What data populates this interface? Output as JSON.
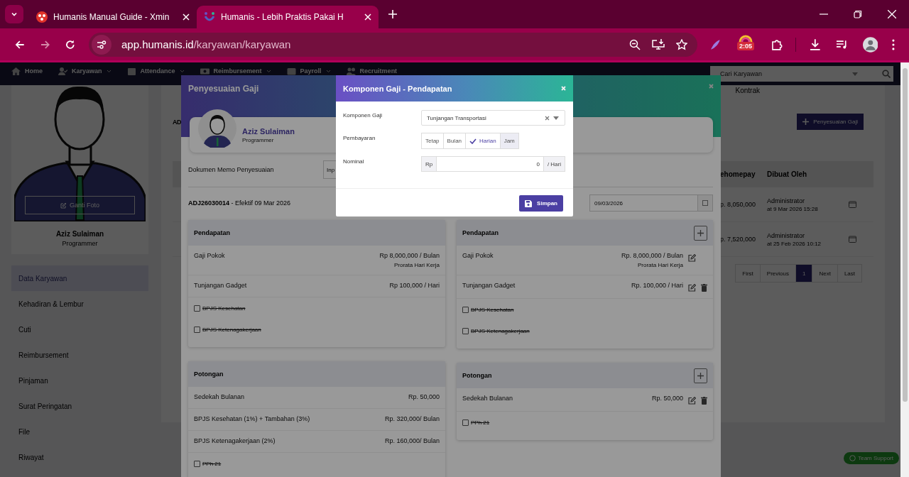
{
  "browser": {
    "tabs": [
      {
        "title": "Humanis Manual Guide - Xmin",
        "selected": false
      },
      {
        "title": "Humanis - Lebih Praktis Pakai H",
        "selected": true
      }
    ],
    "url_host": "app.humanis.id",
    "url_path": "/karyawan/karyawan",
    "extension_badge": "2:05"
  },
  "nav": {
    "items": [
      {
        "label": "Home"
      },
      {
        "label": "Karyawan"
      },
      {
        "label": "Attendance"
      },
      {
        "label": "Reimbursement"
      },
      {
        "label": "Payroll"
      },
      {
        "label": "Recruitment"
      }
    ],
    "search": {
      "placeholder": "Cari Karyawan"
    }
  },
  "sidebar": {
    "photo_button": "Ganti Foto",
    "name": "Aziz Sulaiman",
    "position": "Programmer",
    "menu": [
      {
        "label": "Data Karyawan",
        "selected": true
      },
      {
        "label": "Kehadiran & Lembur",
        "selected": false
      },
      {
        "label": "Cuti",
        "selected": false
      },
      {
        "label": "Reimbursement",
        "selected": false
      },
      {
        "label": "Pinjaman",
        "selected": false
      },
      {
        "label": "Surat Peringatan",
        "selected": false
      },
      {
        "label": "File",
        "selected": false
      },
      {
        "label": "Riwayat",
        "selected": false
      }
    ]
  },
  "main": {
    "cut_heading": "AD",
    "tab": "Kontrak",
    "add_button": "Penyesuaian Gaji",
    "columns": [
      "ehomepay",
      "Dibuat Oleh"
    ],
    "rows": [
      {
        "amount": "p. 8,050,000",
        "created_by": "Administrator",
        "created_at": "at 9 Mar 2026 15:28"
      },
      {
        "amount": "p. 7,520,000",
        "created_by": "Administrator",
        "created_at": "at 25 Feb 2026 10:12"
      }
    ],
    "pagination": [
      {
        "label": "First",
        "selected": false
      },
      {
        "label": "Previous",
        "selected": false
      },
      {
        "label": "1",
        "selected": true
      },
      {
        "label": "Next",
        "selected": false
      },
      {
        "label": "Last",
        "selected": false
      }
    ]
  },
  "support_button": "Team Support",
  "adjustment_modal": {
    "title": "Penyesuaian Gaji",
    "employee": {
      "name": "Aziz Sulaiman",
      "position": "Programmer"
    },
    "memo_label": "Dokumen Memo Penyesuaian",
    "memo_field": "Inp",
    "reference": "**ADJ26030014** - Efektif 09 Mar 2026",
    "date": "09/03/2026",
    "columns": [
      {
        "editable": false,
        "sections": [
          {
            "title": "Pendapatan",
            "items": [
              {
                "kind": "amount",
                "label": "Gaji Pokok",
                "value": "Rp 8,000,000 / Bulan",
                "note": "Prorata Hari Kerja"
              },
              {
                "kind": "amount",
                "label": "Tunjangan Gadget",
                "value": "Rp 100,000 / Hari"
              },
              {
                "kind": "optional",
                "label": "BPJS Kesehatan",
                "checked": false
              },
              {
                "kind": "optional",
                "label": "BPJS Ketenagakerjaan",
                "checked": false
              }
            ]
          },
          {
            "title": "Potongan",
            "items": [
              {
                "kind": "amount",
                "label": "Sedekah Bulanan",
                "value": "Rp. 50,000"
              },
              {
                "kind": "amount",
                "label": "BPJS Kesehatan (1%) + Tambahan (3%)",
                "value": "Rp. 320,000/ Bulan"
              },
              {
                "kind": "amount",
                "label": "BPJS Ketenagakerjaan (2%)",
                "value": "Rp. 160,000/ Bulan"
              },
              {
                "kind": "optional",
                "label": "PPh 21",
                "checked": false
              }
            ]
          }
        ]
      },
      {
        "editable": true,
        "sections": [
          {
            "title": "Pendapatan",
            "items": [
              {
                "kind": "amount",
                "label": "Gaji Pokok",
                "value": "Rp. 8,000,000 / Bulan",
                "note": "Prorata Hari Kerja",
                "deletable": false
              },
              {
                "kind": "amount",
                "label": "Tunjangan Gadget",
                "value": "Rp. 100,000 / Hari",
                "deletable": true
              },
              {
                "kind": "optional",
                "label": "BPJS Kesehatan",
                "checked": false
              },
              {
                "kind": "optional",
                "label": "BPJS Ketenagakerjaan",
                "checked": false
              }
            ]
          },
          {
            "title": "Potongan",
            "items": [
              {
                "kind": "amount",
                "label": "Sedekah Bulanan",
                "value": "Rp. 50,000",
                "deletable": true
              },
              {
                "kind": "optional",
                "label": "PPh 21",
                "checked": false
              }
            ]
          }
        ]
      }
    ]
  },
  "component_modal": {
    "title": "Komponen Gaji - Pendapatan",
    "component_label": "Komponen Gaji",
    "component_value": "Tunjangan Transportasi",
    "payment_label": "Pembayaran",
    "payment_options": [
      {
        "label": "Tetap",
        "selected": false,
        "hovered": false
      },
      {
        "label": "Bulan",
        "selected": false,
        "hovered": false
      },
      {
        "label": "Harian",
        "selected": true,
        "hovered": false
      },
      {
        "label": "Jam",
        "selected": false,
        "hovered": true
      }
    ],
    "nominal_label": "Nominal",
    "currency": "Rp",
    "nominal_value": "0",
    "unit": "/ Hari",
    "save_button": "Simpan"
  }
}
